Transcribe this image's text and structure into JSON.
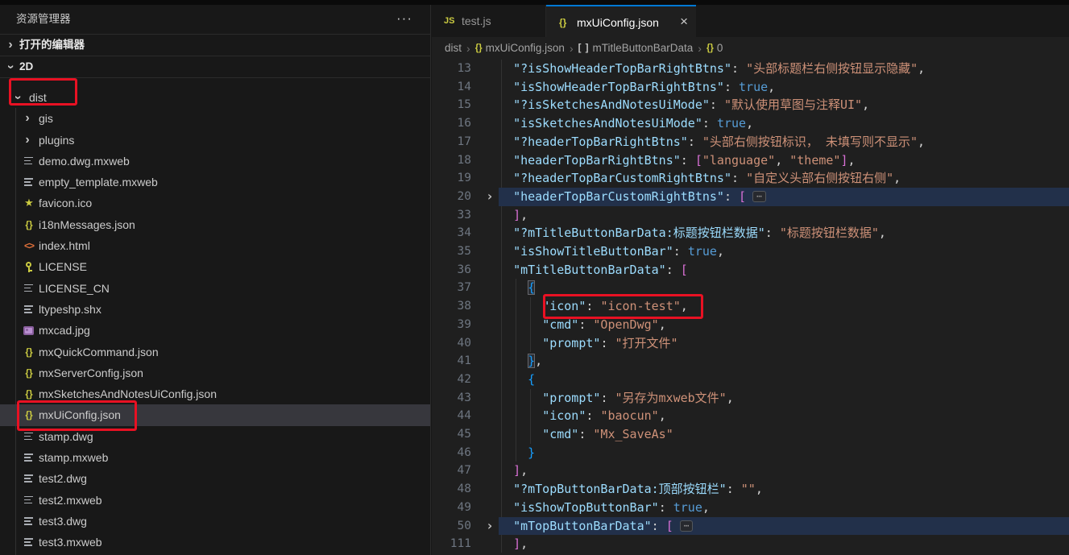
{
  "icons": {
    "ellipsis": "···",
    "chevron": "›",
    "close": "×",
    "fold_badge": "⋯",
    "json_braces": "{}",
    "html_brackets": "<>",
    "star": "★",
    "js_badge": "JS",
    "array_brackets": "[ ]"
  },
  "colors": {
    "accent_tab_border": "#0078d4",
    "annotation_red": "#e81123",
    "selection_row": "#37373d",
    "fold_line_highlight": "#22304a",
    "json_key": "#9cdcfe",
    "json_string": "#ce9178",
    "json_keyword": "#569cd6",
    "bracket_pink": "#da70d6",
    "bracket_blue": "#179fff",
    "seti_yellow": "#cbcb41",
    "seti_orange": "#e0703a",
    "seti_purple": "#8a5f9e"
  },
  "sidebar": {
    "title": "资源管理器",
    "sections": {
      "open_editors": "打开的编辑器",
      "workspace": "2D"
    },
    "tree": [
      {
        "name": "dist",
        "icon": "folder-open",
        "depth": 0,
        "selected": false
      },
      {
        "name": "gis",
        "icon": "folder",
        "depth": 1,
        "selected": false
      },
      {
        "name": "plugins",
        "icon": "folder",
        "depth": 1,
        "selected": false
      },
      {
        "name": "demo.dwg.mxweb",
        "icon": "default-file",
        "depth": 1,
        "selected": false
      },
      {
        "name": "empty_template.mxweb",
        "icon": "default-file",
        "depth": 1,
        "selected": false
      },
      {
        "name": "favicon.ico",
        "icon": "star",
        "depth": 1,
        "selected": false
      },
      {
        "name": "i18nMessages.json",
        "icon": "json",
        "depth": 1,
        "selected": false
      },
      {
        "name": "index.html",
        "icon": "html",
        "depth": 1,
        "selected": false
      },
      {
        "name": "LICENSE",
        "icon": "license-key",
        "depth": 1,
        "selected": false
      },
      {
        "name": "LICENSE_CN",
        "icon": "default-file",
        "depth": 1,
        "selected": false
      },
      {
        "name": "ltypeshp.shx",
        "icon": "default-file",
        "depth": 1,
        "selected": false
      },
      {
        "name": "mxcad.jpg",
        "icon": "image",
        "depth": 1,
        "selected": false
      },
      {
        "name": "mxQuickCommand.json",
        "icon": "json",
        "depth": 1,
        "selected": false
      },
      {
        "name": "mxServerConfig.json",
        "icon": "json",
        "depth": 1,
        "selected": false
      },
      {
        "name": "mxSketchesAndNotesUiConfig.json",
        "icon": "json",
        "depth": 1,
        "selected": false
      },
      {
        "name": "mxUiConfig.json",
        "icon": "json",
        "depth": 1,
        "selected": true
      },
      {
        "name": "stamp.dwg",
        "icon": "default-file",
        "depth": 1,
        "selected": false
      },
      {
        "name": "stamp.mxweb",
        "icon": "default-file",
        "depth": 1,
        "selected": false
      },
      {
        "name": "test2.dwg",
        "icon": "default-file",
        "depth": 1,
        "selected": false
      },
      {
        "name": "test2.mxweb",
        "icon": "default-file",
        "depth": 1,
        "selected": false
      },
      {
        "name": "test3.dwg",
        "icon": "default-file",
        "depth": 1,
        "selected": false
      },
      {
        "name": "test3.mxweb",
        "icon": "default-file",
        "depth": 1,
        "selected": false
      }
    ]
  },
  "editor": {
    "tabs": [
      {
        "label": "test.js",
        "icon": "js",
        "active": false,
        "closable": false
      },
      {
        "label": "mxUiConfig.json",
        "icon": "json",
        "active": true,
        "closable": true
      }
    ],
    "breadcrumb": [
      {
        "label": "dist"
      },
      {
        "label": "mxUiConfig.json",
        "icon": "json"
      },
      {
        "label": "mTitleButtonBarData",
        "icon": "array"
      },
      {
        "label": "0",
        "icon": "json"
      }
    ],
    "code": {
      "language": "json",
      "lines": [
        {
          "num": "13",
          "tokens": [
            [
              "w",
              "  "
            ],
            [
              "k",
              "\"?isShowHeaderTopBarRightBtns\""
            ],
            [
              "p",
              ": "
            ],
            [
              "s",
              "\"头部标题栏右侧按钮显示隐藏\""
            ],
            [
              "p",
              ","
            ]
          ]
        },
        {
          "num": "14",
          "tokens": [
            [
              "w",
              "  "
            ],
            [
              "k",
              "\"isShowHeaderTopBarRightBtns\""
            ],
            [
              "p",
              ": "
            ],
            [
              "b",
              "true"
            ],
            [
              "p",
              ","
            ]
          ]
        },
        {
          "num": "15",
          "tokens": [
            [
              "w",
              "  "
            ],
            [
              "k",
              "\"?isSketchesAndNotesUiMode\""
            ],
            [
              "p",
              ": "
            ],
            [
              "s",
              "\"默认使用草图与注释UI\""
            ],
            [
              "p",
              ","
            ]
          ]
        },
        {
          "num": "16",
          "tokens": [
            [
              "w",
              "  "
            ],
            [
              "k",
              "\"isSketchesAndNotesUiMode\""
            ],
            [
              "p",
              ": "
            ],
            [
              "b",
              "true"
            ],
            [
              "p",
              ","
            ]
          ]
        },
        {
          "num": "17",
          "tokens": [
            [
              "w",
              "  "
            ],
            [
              "k",
              "\"?headerTopBarRightBtns\""
            ],
            [
              "p",
              ": "
            ],
            [
              "s",
              "\"头部右侧按钮标识， 未填写则不显示\""
            ],
            [
              "p",
              ","
            ]
          ]
        },
        {
          "num": "18",
          "tokens": [
            [
              "w",
              "  "
            ],
            [
              "k",
              "\"headerTopBarRightBtns\""
            ],
            [
              "p",
              ": "
            ],
            [
              "pk",
              "["
            ],
            [
              "s",
              "\"language\""
            ],
            [
              "p",
              ", "
            ],
            [
              "s",
              "\"theme\""
            ],
            [
              "pk",
              "]"
            ],
            [
              "p",
              ","
            ]
          ]
        },
        {
          "num": "19",
          "tokens": [
            [
              "w",
              "  "
            ],
            [
              "k",
              "\"?headerTopBarCustomRightBtns\""
            ],
            [
              "p",
              ": "
            ],
            [
              "s",
              "\"自定义头部右侧按钮右侧\""
            ],
            [
              "p",
              ","
            ]
          ]
        },
        {
          "num": "20",
          "fold": true,
          "hl": true,
          "tokens": [
            [
              "w",
              "  "
            ],
            [
              "k",
              "\"headerTopBarCustomRightBtns\""
            ],
            [
              "p",
              ": "
            ],
            [
              "pk",
              "["
            ],
            [
              "fold",
              "⋯"
            ]
          ]
        },
        {
          "num": "33",
          "tokens": [
            [
              "w",
              "  "
            ],
            [
              "pk",
              "]"
            ],
            [
              "p",
              ","
            ]
          ]
        },
        {
          "num": "34",
          "tokens": [
            [
              "w",
              "  "
            ],
            [
              "k",
              "\"?mTitleButtonBarData:标题按钮栏数据\""
            ],
            [
              "p",
              ": "
            ],
            [
              "s",
              "\"标题按钮栏数据\""
            ],
            [
              "p",
              ","
            ]
          ]
        },
        {
          "num": "35",
          "tokens": [
            [
              "w",
              "  "
            ],
            [
              "k",
              "\"isShowTitleButtonBar\""
            ],
            [
              "p",
              ": "
            ],
            [
              "b",
              "true"
            ],
            [
              "p",
              ","
            ]
          ]
        },
        {
          "num": "36",
          "tokens": [
            [
              "w",
              "  "
            ],
            [
              "k",
              "\"mTitleButtonBarData\""
            ],
            [
              "p",
              ": "
            ],
            [
              "pk",
              "["
            ]
          ]
        },
        {
          "num": "37",
          "tokens": [
            [
              "w",
              "    "
            ],
            [
              "bm",
              "{"
            ]
          ]
        },
        {
          "num": "38",
          "tokens": [
            [
              "w",
              "      "
            ],
            [
              "k",
              "\"icon\""
            ],
            [
              "p",
              ": "
            ],
            [
              "s",
              "\"icon-test\""
            ],
            [
              "p",
              ","
            ]
          ]
        },
        {
          "num": "39",
          "tokens": [
            [
              "w",
              "      "
            ],
            [
              "k",
              "\"cmd\""
            ],
            [
              "p",
              ": "
            ],
            [
              "s",
              "\"OpenDwg\""
            ],
            [
              "p",
              ","
            ]
          ]
        },
        {
          "num": "40",
          "tokens": [
            [
              "w",
              "      "
            ],
            [
              "k",
              "\"prompt\""
            ],
            [
              "p",
              ": "
            ],
            [
              "s",
              "\"打开文件\""
            ]
          ]
        },
        {
          "num": "41",
          "tokens": [
            [
              "w",
              "    "
            ],
            [
              "bm",
              "}"
            ],
            [
              "p",
              ","
            ]
          ]
        },
        {
          "num": "42",
          "tokens": [
            [
              "w",
              "    "
            ],
            [
              "bb",
              "{"
            ]
          ]
        },
        {
          "num": "43",
          "tokens": [
            [
              "w",
              "      "
            ],
            [
              "k",
              "\"prompt\""
            ],
            [
              "p",
              ": "
            ],
            [
              "s",
              "\"另存为mxweb文件\""
            ],
            [
              "p",
              ","
            ]
          ]
        },
        {
          "num": "44",
          "tokens": [
            [
              "w",
              "      "
            ],
            [
              "k",
              "\"icon\""
            ],
            [
              "p",
              ": "
            ],
            [
              "s",
              "\"baocun\""
            ],
            [
              "p",
              ","
            ]
          ]
        },
        {
          "num": "45",
          "tokens": [
            [
              "w",
              "      "
            ],
            [
              "k",
              "\"cmd\""
            ],
            [
              "p",
              ": "
            ],
            [
              "s",
              "\"Mx_SaveAs\""
            ]
          ]
        },
        {
          "num": "46",
          "tokens": [
            [
              "w",
              "    "
            ],
            [
              "bb",
              "}"
            ]
          ]
        },
        {
          "num": "47",
          "tokens": [
            [
              "w",
              "  "
            ],
            [
              "pk",
              "]"
            ],
            [
              "p",
              ","
            ]
          ]
        },
        {
          "num": "48",
          "tokens": [
            [
              "w",
              "  "
            ],
            [
              "k",
              "\"?mTopButtonBarData:顶部按钮栏\""
            ],
            [
              "p",
              ": "
            ],
            [
              "s",
              "\"\""
            ],
            [
              "p",
              ","
            ]
          ]
        },
        {
          "num": "49",
          "tokens": [
            [
              "w",
              "  "
            ],
            [
              "k",
              "\"isShowTopButtonBar\""
            ],
            [
              "p",
              ": "
            ],
            [
              "b",
              "true"
            ],
            [
              "p",
              ","
            ]
          ]
        },
        {
          "num": "50",
          "fold": true,
          "hl": true,
          "tokens": [
            [
              "w",
              "  "
            ],
            [
              "k",
              "\"mTopButtonBarData\""
            ],
            [
              "p",
              ": "
            ],
            [
              "pk",
              "["
            ],
            [
              "fold",
              "⋯"
            ]
          ]
        },
        {
          "num": "111",
          "tokens": [
            [
              "w",
              "  "
            ],
            [
              "pk",
              "]"
            ],
            [
              "p",
              ","
            ]
          ]
        }
      ]
    }
  }
}
